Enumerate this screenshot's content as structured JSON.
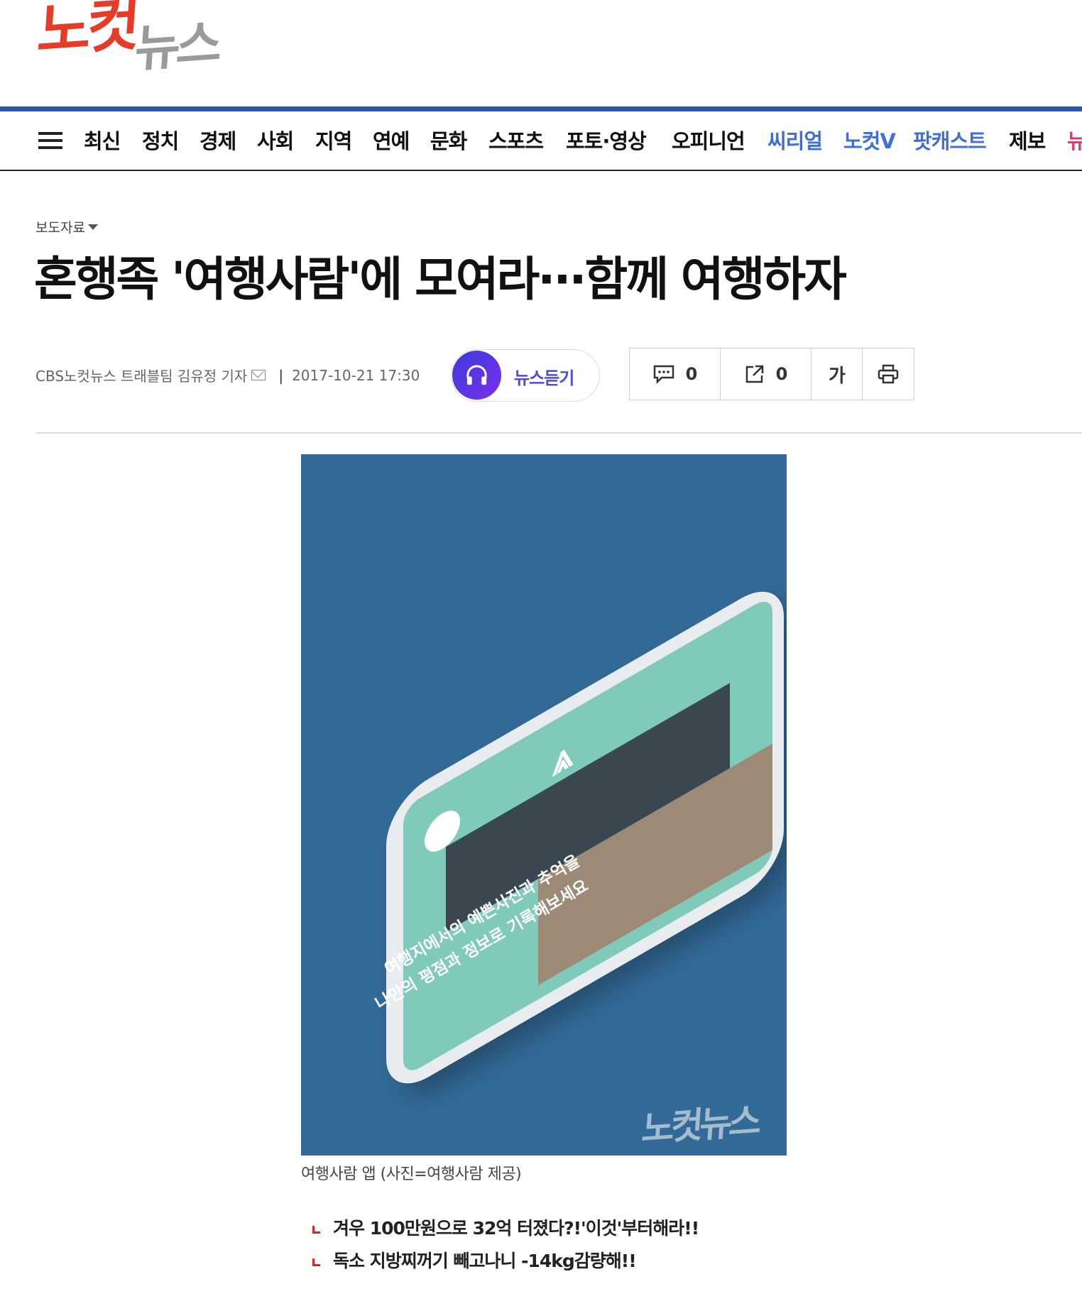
{
  "header": {
    "logo": {
      "part1": "노컷",
      "part2": "뉴스"
    }
  },
  "nav": {
    "items": [
      {
        "label": "최신",
        "color": "#111111"
      },
      {
        "label": "정치",
        "color": "#111111"
      },
      {
        "label": "경제",
        "color": "#111111"
      },
      {
        "label": "사회",
        "color": "#111111"
      },
      {
        "label": "지역",
        "color": "#111111"
      },
      {
        "label": "연예",
        "color": "#111111"
      },
      {
        "label": "문화",
        "color": "#111111"
      },
      {
        "label": "스포츠",
        "color": "#111111"
      },
      {
        "label": "포토·영상",
        "color": "#111111"
      },
      {
        "label": "오피니언",
        "color": "#111111"
      },
      {
        "label": "씨리얼",
        "color": "#3f6fd3"
      },
      {
        "label": "노컷V",
        "color": "#3f6fd3"
      },
      {
        "label": "팟캐스트",
        "color": "#3f6fd3"
      },
      {
        "label": "제보",
        "color": "#111111"
      },
      {
        "label": "뉴",
        "color": "#e0357a"
      }
    ]
  },
  "article": {
    "category": "보도자료",
    "headline": "혼행족 '여행사람'에 모여라···함께 여행하자",
    "byline": {
      "author": "CBS노컷뉴스 트래블팀 김유정 기자",
      "separator": "|",
      "datetime": "2017-10-21 17:30"
    },
    "listen_label": "뉴스듣기",
    "tools": {
      "comment_count": "0",
      "share_count": "0",
      "font_label": "가"
    },
    "image": {
      "overlay_line1": "여행지에서의 예쁜사진과 추억을",
      "overlay_line2": "나만의 평점과 정보로 기록해보세요",
      "watermark": "노컷뉴스",
      "caption": "여행사람 앱 (사진=여행사람 제공)",
      "background_color": "#336a97"
    },
    "related": [
      "겨우 100만원으로 32억 터졌다?!'이것'부터해라!!",
      "독소 지방찌꺼기 빼고나니 -14kg감량해!!"
    ]
  }
}
